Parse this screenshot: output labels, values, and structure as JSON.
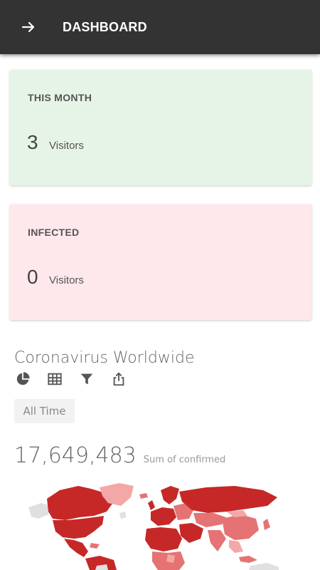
{
  "app_bar": {
    "title": "DASHBOARD",
    "back_icon": "arrow-right-icon",
    "background": "#333333"
  },
  "cards": [
    {
      "label": "THIS MONTH",
      "value": "3",
      "unit": "Visitors",
      "color": "#e6f4e7"
    },
    {
      "label": "INFECTED",
      "value": "0",
      "unit": "Visitors",
      "color": "#ffe8eb"
    }
  ],
  "embed": {
    "title": "Coronavirus Worldwide",
    "toolbar_icons": [
      "pie-chart-icon",
      "table-icon",
      "filter-icon",
      "share-icon"
    ],
    "filter_label": "All Time",
    "total_value": "17,649,483",
    "total_caption": "Sum of confirmed",
    "map_colors": [
      "#c62828",
      "#e57373",
      "#f4a7a7",
      "#dddddd"
    ]
  }
}
